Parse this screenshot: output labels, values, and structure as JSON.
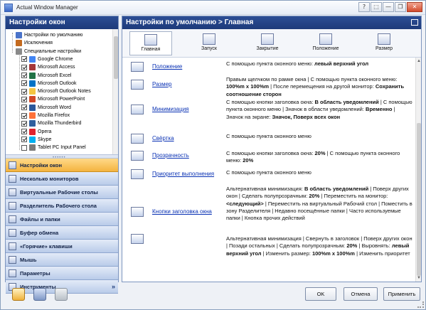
{
  "window": {
    "title": "Actual Window Manager",
    "controls": [
      "?",
      "⬚",
      "—",
      "❐",
      "✕"
    ]
  },
  "left_panel": {
    "header": "Настройки окон",
    "tree": [
      {
        "label": "Настройки по умолчанию",
        "checkbox": false,
        "icon": "window-icon"
      },
      {
        "label": "Исключения",
        "checkbox": false,
        "icon": "exclusions-icon"
      },
      {
        "label": "Специальные настройки",
        "checkbox": false,
        "icon": "special-icon"
      },
      {
        "label": "Google Chrome",
        "checkbox": true,
        "icon": "chrome-icon"
      },
      {
        "label": "Microsoft Access",
        "checkbox": true,
        "icon": "access-icon"
      },
      {
        "label": "Microsoft Excel",
        "checkbox": true,
        "icon": "excel-icon"
      },
      {
        "label": "Microsoft Outlook",
        "checkbox": true,
        "icon": "outlook-icon"
      },
      {
        "label": "Microsoft Outlook Notes",
        "checkbox": true,
        "icon": "notes-icon"
      },
      {
        "label": "Microsoft PowerPoint",
        "checkbox": true,
        "icon": "powerpoint-icon"
      },
      {
        "label": "Microsoft Word",
        "checkbox": true,
        "icon": "word-icon"
      },
      {
        "label": "Mozilla Firefox",
        "checkbox": true,
        "icon": "firefox-icon"
      },
      {
        "label": "Mozilla Thunderbird",
        "checkbox": true,
        "icon": "thunderbird-icon"
      },
      {
        "label": "Opera",
        "checkbox": true,
        "icon": "opera-icon"
      },
      {
        "label": "Skype",
        "checkbox": true,
        "icon": "skype-icon"
      },
      {
        "label": "Tablet PC Input Panel",
        "checkbox": false,
        "icon": "tablet-icon"
      }
    ],
    "nav": [
      {
        "label": "Настройки окон",
        "active": true
      },
      {
        "label": "Несколько мониторов",
        "active": false
      },
      {
        "label": "Виртуальные Рабочие столы",
        "active": false
      },
      {
        "label": "Разделитель Рабочего стола",
        "active": false
      },
      {
        "label": "Файлы и папки",
        "active": false
      },
      {
        "label": "Буфер обмена",
        "active": false
      },
      {
        "label": "«Горячие» клавиши",
        "active": false
      },
      {
        "label": "Мышь",
        "active": false
      },
      {
        "label": "Параметры",
        "active": false
      },
      {
        "label": "Инструменты",
        "active": false
      }
    ],
    "nav_more": "»"
  },
  "right_panel": {
    "header": "Настройки по умолчанию > Главная",
    "tabs": [
      "Главная",
      "Запуск",
      "Закрытие",
      "Положение",
      "Размер"
    ],
    "active_tab": "Главная",
    "items": [
      {
        "link": "Положение",
        "desc": [
          [
            "С помощью пункта оконного меню: ",
            false
          ],
          [
            "левый верхний угол",
            true
          ]
        ]
      },
      {
        "link": "Размер",
        "desc": [
          [
            "Правым щелчком по рамке окна | С помощью пункта оконного меню: ",
            false
          ],
          [
            "100%m x 100%m",
            true
          ],
          [
            " | После перемещения на другой монитор: ",
            false
          ],
          [
            "Сохранить соотношение сторон",
            true
          ]
        ]
      },
      {
        "link": "Минимизация",
        "desc": [
          [
            "С помощью кнопки заголовка окна: ",
            false
          ],
          [
            "В область уведомлений",
            true
          ],
          [
            " | С помощью пункта оконного меню | Значок в области уведомлений: ",
            false
          ],
          [
            "Временно",
            true
          ],
          [
            " | Значок на экране: ",
            false
          ],
          [
            "Значок, Поверх всех окон",
            true
          ]
        ]
      },
      {
        "link": "Свёртка",
        "desc": [
          [
            "С помощью пункта оконного меню",
            false
          ]
        ]
      },
      {
        "link": "Прозрачность",
        "desc": [
          [
            "С помощью кнопки заголовка окна: ",
            false
          ],
          [
            "20%",
            true
          ],
          [
            " | С помощью пункта оконного меню: ",
            false
          ],
          [
            "20%",
            true
          ]
        ]
      },
      {
        "link": "Приоритет выполнения",
        "desc": [
          [
            "С помощью пункта оконного меню",
            false
          ]
        ]
      },
      {
        "link": "Кнопки заголовка окна",
        "desc": [
          [
            "Альтернативная минимизация: ",
            false
          ],
          [
            "В область уведомлений",
            true
          ],
          [
            " | Поверх других окон | Сделать полупрозрачным: ",
            false
          ],
          [
            "20%",
            true
          ],
          [
            " | Переместить на монитор: ",
            false
          ],
          [
            "<следующий>",
            true
          ],
          [
            " | Переместить на виртуальный Рабочий стол | Поместить в зону Разделителя | Недавно посещённые папки | Часто используемые папки | Кнопка прочих действий",
            false
          ]
        ]
      },
      {
        "link": "",
        "desc": [
          [
            "Альтернативная минимизация | Свернуть в заголовок | Поверх других окон | Позади остальных | Сделать полупрозрачным: ",
            false
          ],
          [
            "20%",
            true
          ],
          [
            " | Выровнять: ",
            false
          ],
          [
            "левый верхний угол",
            true
          ],
          [
            " | Изменить размер: ",
            false
          ],
          [
            "100%m x 100%m",
            true
          ],
          [
            " | Изменить приоритет",
            false
          ]
        ]
      }
    ]
  },
  "footer": {
    "ok": "OK",
    "cancel": "Отмена",
    "apply": "Применить"
  }
}
